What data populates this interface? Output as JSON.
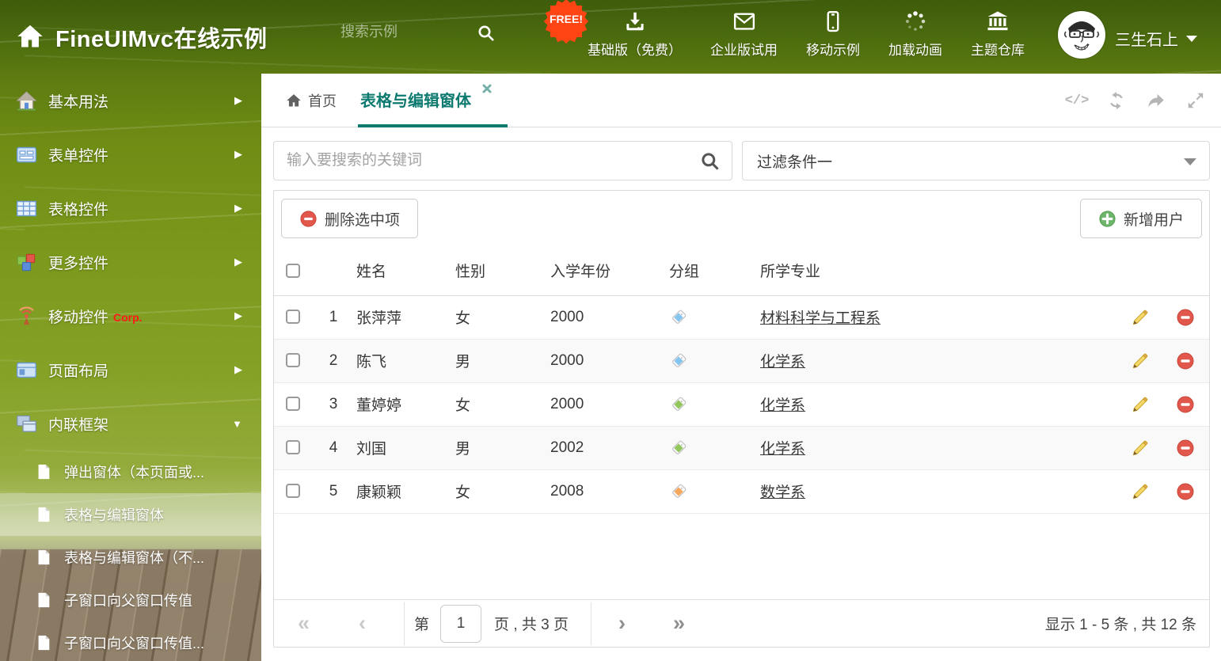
{
  "header": {
    "logo_text": "FineUIMvc在线示例",
    "search_placeholder": "搜索示例",
    "free_badge": "FREE!",
    "nav_items": [
      {
        "icon": "download-icon",
        "label": "基础版（免费）"
      },
      {
        "icon": "mail-icon",
        "label": "企业版试用"
      },
      {
        "icon": "phone-icon",
        "label": "移动示例"
      },
      {
        "icon": "spinner-icon",
        "label": "加载动画"
      },
      {
        "icon": "bank-icon",
        "label": "主题仓库"
      }
    ],
    "user_name": "三生石上"
  },
  "sidebar": {
    "items": [
      {
        "icon": "house-icon",
        "label": "基本用法"
      },
      {
        "icon": "form-icon",
        "label": "表单控件"
      },
      {
        "icon": "table-icon",
        "label": "表格控件"
      },
      {
        "icon": "cubes-icon",
        "label": "更多控件"
      },
      {
        "icon": "signal-icon",
        "label": "移动控件",
        "badge": "Corp."
      },
      {
        "icon": "layout-icon",
        "label": "页面布局"
      },
      {
        "icon": "frames-icon",
        "label": "内联框架"
      }
    ],
    "subitems": [
      {
        "label": "弹出窗体（本页面或..."
      },
      {
        "label": "表格与编辑窗体"
      },
      {
        "label": "表格与编辑窗体（不..."
      },
      {
        "label": "子窗口向父窗口传值"
      },
      {
        "label": "子窗口向父窗口传值..."
      }
    ]
  },
  "tabs": {
    "home": "首页",
    "active": "表格与编辑窗体"
  },
  "filters": {
    "search_placeholder": "输入要搜索的关键词",
    "filter_value": "过滤条件一"
  },
  "grid": {
    "delete_button": "删除选中项",
    "add_button": "新增用户",
    "columns": {
      "name": "姓名",
      "gender": "性别",
      "year": "入学年份",
      "group": "分组",
      "major": "所学专业"
    },
    "rows": [
      {
        "num": "1",
        "name": "张萍萍",
        "gender": "女",
        "year": "2000",
        "tag_color": "#86c5f0",
        "major": "材料科学与工程系"
      },
      {
        "num": "2",
        "name": "陈飞",
        "gender": "男",
        "year": "2000",
        "tag_color": "#86c5f0",
        "major": "化学系"
      },
      {
        "num": "3",
        "name": "董婷婷",
        "gender": "女",
        "year": "2000",
        "tag_color": "#93c65c",
        "major": "化学系"
      },
      {
        "num": "4",
        "name": "刘国",
        "gender": "男",
        "year": "2002",
        "tag_color": "#93c65c",
        "major": "化学系"
      },
      {
        "num": "5",
        "name": "康颖颖",
        "gender": "女",
        "year": "2008",
        "tag_color": "#f7a85c",
        "major": "数学系"
      }
    ],
    "pagination": {
      "prefix": "第",
      "current_page": "1",
      "suffix": "页 , 共 3 页",
      "summary": "显示 1 - 5 条 , 共 12 条"
    }
  },
  "colors": {
    "accent_teal": "#0d7a70",
    "free_badge": "#ff4514",
    "delete_red": "#e2574c",
    "add_green": "#6cb56a",
    "pencil_yellow": "#f6d96b"
  }
}
